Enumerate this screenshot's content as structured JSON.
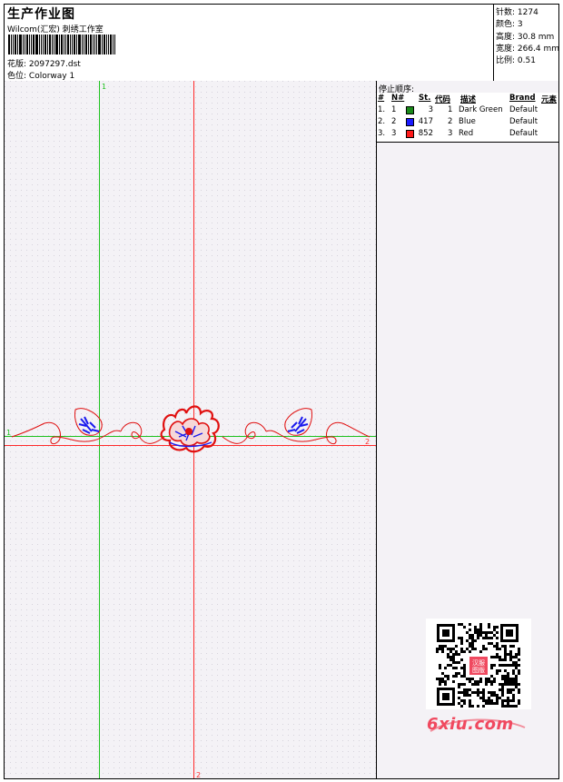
{
  "header": {
    "title": "生产作业图",
    "subtitle": "Wilcom(汇宏) 刺绣工作室",
    "design_label": "花版:",
    "design_value": "2097297.dst",
    "colorway_label": "色位:",
    "colorway_value": "Colorway 1"
  },
  "stats": {
    "stitches": "针数: 1274",
    "colors": "颜色: 3",
    "height": "高度: 30.8 mm",
    "width": "宽度: 266.4 mm",
    "scale": "比例: 0.51"
  },
  "canvas": {
    "marker_green_top": "1",
    "marker_green_left": "1",
    "marker_red_bottom": "2",
    "marker_red_right": "2"
  },
  "stop_sequence": {
    "title": "停止顺序:",
    "columns": [
      "#",
      "N#",
      "St.",
      "代码",
      "描述",
      "Brand",
      "元素"
    ],
    "rows": [
      {
        "idx": "1.",
        "n": "1",
        "color": "#1a8a1a",
        "stitches": "3",
        "code": "1",
        "desc": "Dark Green",
        "brand": "Default"
      },
      {
        "idx": "2.",
        "n": "2",
        "color": "#1a1aff",
        "stitches": "417",
        "code": "2",
        "desc": "Blue",
        "brand": "Default"
      },
      {
        "idx": "3.",
        "n": "3",
        "color": "#ff1a1a",
        "stitches": "852",
        "code": "3",
        "desc": "Red",
        "brand": "Default"
      }
    ]
  },
  "watermark": {
    "qr_label": "汉服图版",
    "site": "6xiu.com"
  },
  "colors": {
    "green_axis": "#1fc21f",
    "red_axis": "#ff2a2a",
    "embroidery_red": "#e01010",
    "embroidery_blue": "#1a1aee",
    "watermark": "#f0495f"
  }
}
